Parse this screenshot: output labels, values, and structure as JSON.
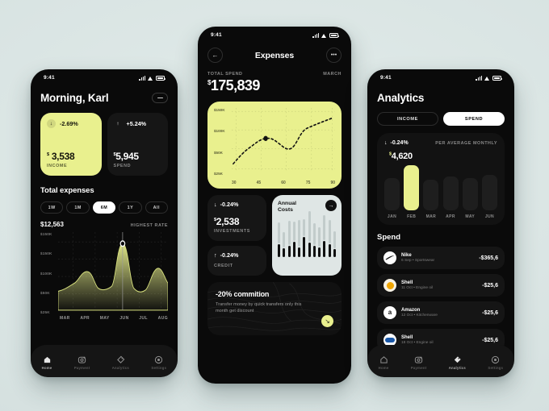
{
  "theme": {
    "accent": "#e9f08e",
    "bg": "#dde7e6",
    "card": "#161616"
  },
  "phone1": {
    "status": {
      "time": "9:41"
    },
    "greeting": "Morning, Karl",
    "cards": [
      {
        "pct": "-2.69%",
        "dir": "↓",
        "amount": "3,538",
        "currency": "$",
        "label": "INCOME"
      },
      {
        "pct": "+5.24%",
        "dir": "↑",
        "amount": "5,945",
        "currency": "$",
        "label": "SPEND"
      }
    ],
    "section_title": "Total expenses",
    "ranges": [
      {
        "label": "1W",
        "active": false
      },
      {
        "label": "1M",
        "active": false
      },
      {
        "label": "6M",
        "active": true
      },
      {
        "label": "1Y",
        "active": false
      },
      {
        "label": "All",
        "active": false
      }
    ],
    "rate_value": "$12,563",
    "rate_label": "HIGHEST RATE",
    "nav": [
      {
        "label": "Home",
        "icon": "home-icon",
        "active": true
      },
      {
        "label": "Payment",
        "icon": "payment-icon",
        "active": false
      },
      {
        "label": "Analytics",
        "icon": "analytics-tag-icon",
        "active": false
      },
      {
        "label": "Settings",
        "icon": "settings-gear-icon",
        "active": false
      }
    ]
  },
  "phone2": {
    "status": {
      "time": "9:41"
    },
    "title": "Expenses",
    "back_icon": "back-arrow-icon",
    "more_icon": "more-dots-icon",
    "total_label": "TOTAL SPEND",
    "month": "MARCH",
    "total_currency": "$",
    "total_amount": "175,839",
    "mini_cards": [
      {
        "pct": "-0.24%",
        "dir": "↓",
        "currency": "$",
        "amount": "2,538",
        "label": "INVESTMENTS"
      },
      {
        "pct": "-0.24%",
        "dir": "↑",
        "label": "CREDIT"
      }
    ],
    "annual": {
      "title": "Annual\nCosts",
      "title_l1": "Annual",
      "title_l2": "Costs",
      "go_icon": "arrow-right-icon"
    },
    "promo": {
      "headline": "-20% commition",
      "body": "Transfer money by quick transfers only this month get discount",
      "fab_icon": "arrow-down-right-icon"
    }
  },
  "phone3": {
    "status": {
      "time": "9:41"
    },
    "title": "Analytics",
    "tabs": [
      {
        "label": "INCOME",
        "active": false
      },
      {
        "label": "SPEND",
        "active": true
      }
    ],
    "delta": "-0.24%",
    "delta_dir": "↓",
    "delta_caption": "PER AVERAGE MONTHLY",
    "highlight_currency": "$",
    "highlight_amount": "4,620",
    "spend_header": "Spend",
    "transactions": [
      {
        "name": "Nike",
        "sub": "6 Sep • Sportswear",
        "amount": "-$365,6",
        "icon": "nike-swoosh-icon",
        "icon_bg": "#ffffff",
        "icon_fg": "#000000",
        "glyph": "✔"
      },
      {
        "name": "Shell",
        "sub": "11 Oct • Engine oil",
        "amount": "-$25,6",
        "icon": "shell-logo-icon",
        "icon_bg": "#f5f0e6",
        "icon_fg": "#f0a500",
        "glyph": "●"
      },
      {
        "name": "Amazon",
        "sub": "12 Oct • Kitchenware",
        "amount": "-$25,6",
        "icon": "amazon-logo-icon",
        "icon_bg": "#ffffff",
        "icon_fg": "#111111",
        "glyph": "a"
      },
      {
        "name": "Shell",
        "sub": "18 Oct • Engine oil",
        "amount": "-$25,6",
        "icon": "shell-blue-icon",
        "icon_bg": "#ffffff",
        "icon_fg": "#1a58a8",
        "glyph": "▬"
      }
    ],
    "nav": [
      {
        "label": "Home",
        "icon": "home-icon",
        "active": false
      },
      {
        "label": "Payment",
        "icon": "payment-icon",
        "active": false
      },
      {
        "label": "Analytics",
        "icon": "analytics-tag-icon",
        "active": true
      },
      {
        "label": "Settings",
        "icon": "settings-gear-icon",
        "active": false
      }
    ]
  },
  "chart_data": [
    {
      "type": "area",
      "id": "total-expenses-area",
      "title": "Total expenses",
      "ylabel": "",
      "xlabel": "",
      "ytick_labels": [
        "$150K",
        "$150K",
        "$100K",
        "$50K",
        "$25K"
      ],
      "categories": [
        "MAR",
        "APR",
        "MAY",
        "JUN",
        "JUL",
        "AUG"
      ],
      "ylim": [
        0,
        160
      ],
      "grid": true,
      "marker": {
        "category": "JUN",
        "value": 148
      },
      "values": [
        48,
        52,
        80,
        58,
        55,
        148,
        62,
        55,
        92,
        70
      ],
      "x": [
        0,
        8,
        20,
        30,
        42,
        58,
        66,
        76,
        88,
        100
      ]
    },
    {
      "type": "line",
      "id": "expenses-dotted-line",
      "ytick_labels": [
        "$150K",
        "$100K",
        "$50K",
        "$25K"
      ],
      "xtick_labels": [
        "30",
        "45",
        "60",
        "75",
        "90"
      ],
      "grid": true,
      "style": "dotted",
      "marker": {
        "x": 42,
        "y": 72
      },
      "x": [
        0,
        10,
        22,
        34,
        42,
        52,
        62,
        70,
        80,
        90,
        100
      ],
      "values": [
        28,
        44,
        54,
        64,
        72,
        76,
        70,
        66,
        82,
        96,
        104
      ],
      "ylim": [
        0,
        160
      ]
    },
    {
      "type": "bar",
      "id": "annual-costs-bars",
      "title": "Annual Costs",
      "grid": false,
      "series": [
        {
          "name": "light",
          "values": [
            62,
            46,
            72,
            58,
            80,
            52,
            92,
            66,
            58,
            74,
            70,
            52
          ]
        },
        {
          "name": "dark",
          "values": [
            40,
            28,
            34,
            46,
            30,
            62,
            44,
            34,
            30,
            48,
            40,
            26
          ]
        }
      ]
    },
    {
      "type": "bar",
      "id": "monthly-spend-bars",
      "categories": [
        "JAN",
        "FEB",
        "MAR",
        "APR",
        "MAY",
        "JUN"
      ],
      "values": [
        40,
        56,
        38,
        42,
        40,
        44
      ],
      "highlight_index": 1,
      "highlight_label": "$4,620",
      "grid": false,
      "ylim": [
        0,
        60
      ]
    }
  ]
}
